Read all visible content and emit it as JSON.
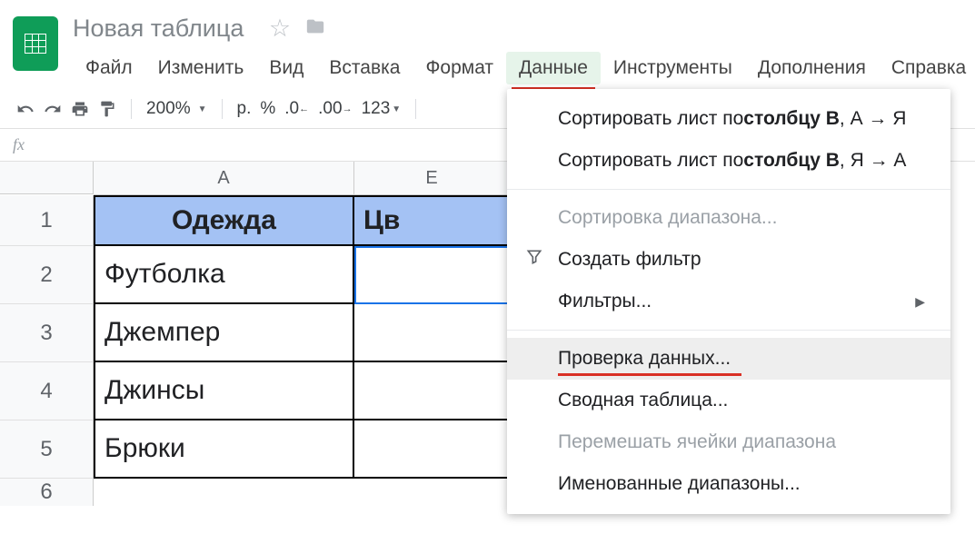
{
  "header": {
    "doc_title": "Новая таблица"
  },
  "menubar": {
    "file": "Файл",
    "edit": "Изменить",
    "view": "Вид",
    "insert": "Вставка",
    "format": "Формат",
    "data": "Данные",
    "tools": "Инструменты",
    "addons": "Дополнения",
    "help": "Справка"
  },
  "toolbar": {
    "zoom": "200%",
    "currency": "р.",
    "percent": "%",
    "dec_dec": ".0",
    "dec_inc": ".00",
    "more_formats": "123"
  },
  "formula_bar": {
    "fx": "fx"
  },
  "columns": {
    "A": "A",
    "B_partial": "Е"
  },
  "rows": [
    "1",
    "2",
    "3",
    "4",
    "5",
    "6"
  ],
  "cells": {
    "A1": "Одежда",
    "B1": "Цв",
    "A2": "Футболка",
    "A3": "Джемпер",
    "A4": "Джинсы",
    "A5": "Брюки"
  },
  "dropdown": {
    "sort_asc_prefix": "Сортировать лист по ",
    "sort_col_bold": "столбцу B",
    "sort_asc_suffix": ", А → Я",
    "sort_desc_suffix": ", Я → А",
    "sort_range": "Сортировка диапазона...",
    "create_filter": "Создать фильтр",
    "filters": "Фильтры...",
    "data_validation": "Проверка данных...",
    "pivot_table": "Сводная таблица...",
    "randomize": "Перемешать ячейки диапазона",
    "named_ranges": "Именованные диапазоны..."
  }
}
